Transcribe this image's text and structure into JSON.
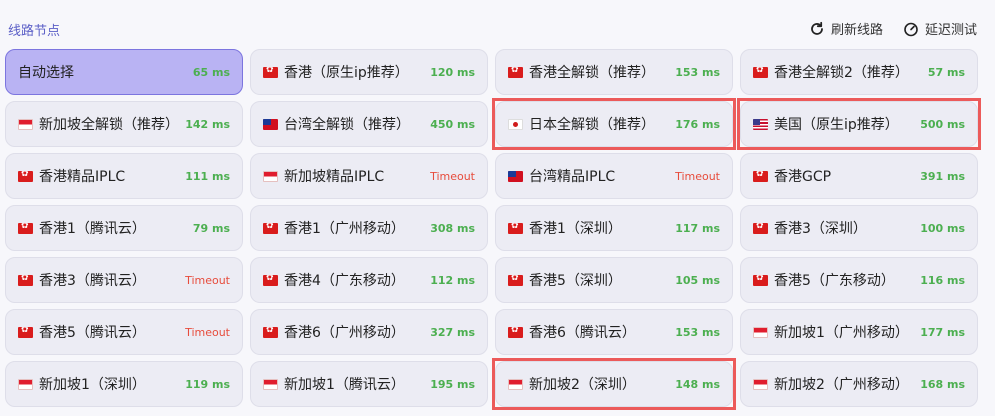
{
  "header": {
    "title": "线路节点",
    "refresh_label": "刷新线路",
    "delay_test_label": "延迟测试"
  },
  "colors": {
    "accent": "#5b5fc7",
    "selected_bg": "#b9b3f3",
    "delay_ok": "#4caf50",
    "delay_timeout": "#e74c3c",
    "highlight": "#ec5a5a"
  },
  "nodes": [
    {
      "name": "自动选择",
      "flag": "",
      "delay": "65 ms",
      "selected": true
    },
    {
      "name": "香港（原生ip推荐）",
      "flag": "hk",
      "delay": "120 ms"
    },
    {
      "name": "香港全解锁（推荐）",
      "flag": "hk",
      "delay": "153 ms"
    },
    {
      "name": "香港全解锁2（推荐）",
      "flag": "hk",
      "delay": "57 ms"
    },
    {
      "name": "新加坡全解锁（推荐）",
      "flag": "sg",
      "delay": "142 ms"
    },
    {
      "name": "台湾全解锁（推荐）",
      "flag": "tw",
      "delay": "450 ms"
    },
    {
      "name": "日本全解锁（推荐）",
      "flag": "jp",
      "delay": "176 ms",
      "highlighted": true
    },
    {
      "name": "美国（原生ip推荐）",
      "flag": "us",
      "delay": "500 ms",
      "highlighted": true
    },
    {
      "name": "香港精品IPLC",
      "flag": "hk",
      "delay": "111 ms"
    },
    {
      "name": "新加坡精品IPLC",
      "flag": "sg",
      "delay": "Timeout"
    },
    {
      "name": "台湾精品IPLC",
      "flag": "tw",
      "delay": "Timeout"
    },
    {
      "name": "香港GCP",
      "flag": "hk",
      "delay": "391 ms"
    },
    {
      "name": "香港1（腾讯云）",
      "flag": "hk",
      "delay": "79 ms"
    },
    {
      "name": "香港1（广州移动）",
      "flag": "hk",
      "delay": "308 ms"
    },
    {
      "name": "香港1（深圳）",
      "flag": "hk",
      "delay": "117 ms"
    },
    {
      "name": "香港3（深圳）",
      "flag": "hk",
      "delay": "100 ms"
    },
    {
      "name": "香港3（腾讯云）",
      "flag": "hk",
      "delay": "Timeout"
    },
    {
      "name": "香港4（广东移动）",
      "flag": "hk",
      "delay": "112 ms"
    },
    {
      "name": "香港5（深圳）",
      "flag": "hk",
      "delay": "105 ms"
    },
    {
      "name": "香港5（广东移动）",
      "flag": "hk",
      "delay": "116 ms"
    },
    {
      "name": "香港5（腾讯云）",
      "flag": "hk",
      "delay": "Timeout"
    },
    {
      "name": "香港6（广州移动）",
      "flag": "hk",
      "delay": "327 ms"
    },
    {
      "name": "香港6（腾讯云）",
      "flag": "hk",
      "delay": "153 ms"
    },
    {
      "name": "新加坡1（广州移动）",
      "flag": "sg",
      "delay": "177 ms"
    },
    {
      "name": "新加坡1（深圳）",
      "flag": "sg",
      "delay": "119 ms"
    },
    {
      "name": "新加坡1（腾讯云）",
      "flag": "sg",
      "delay": "195 ms"
    },
    {
      "name": "新加坡2（深圳）",
      "flag": "sg",
      "delay": "148 ms",
      "highlighted": true
    },
    {
      "name": "新加坡2（广州移动）",
      "flag": "sg",
      "delay": "168 ms"
    }
  ]
}
